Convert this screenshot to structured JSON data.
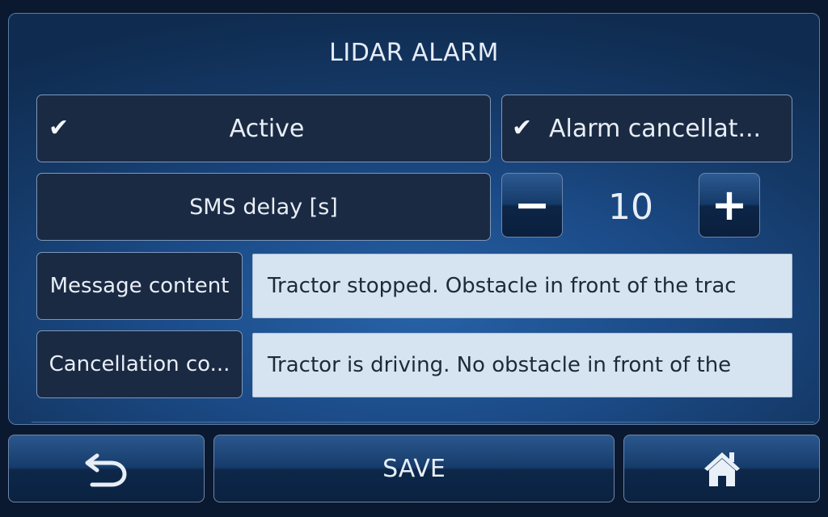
{
  "header": {
    "title": "LIDAR ALARM"
  },
  "settings": {
    "active": {
      "label": "Active",
      "checked": true,
      "check_glyph": "✔"
    },
    "alarm_cancellation": {
      "label": "Alarm cancellat...",
      "checked": true,
      "check_glyph": "✔"
    },
    "sms_delay": {
      "label": "SMS delay [s]",
      "value": "10",
      "minus_label": "−",
      "plus_label": "+"
    },
    "message_content": {
      "label": "Message content",
      "value": "Tractor stopped. Obstacle in front of the trac"
    },
    "cancellation_content": {
      "label": "Cancellation co...",
      "value": "Tractor is driving. No obstacle in front of the"
    }
  },
  "footer": {
    "back_icon": "undo-arrow-icon",
    "save_label": "SAVE",
    "home_icon": "home-icon"
  },
  "colors": {
    "panel_accent": "#1b4a86",
    "field_background": "#d6e3f0",
    "box_background": "#1b2a43"
  }
}
